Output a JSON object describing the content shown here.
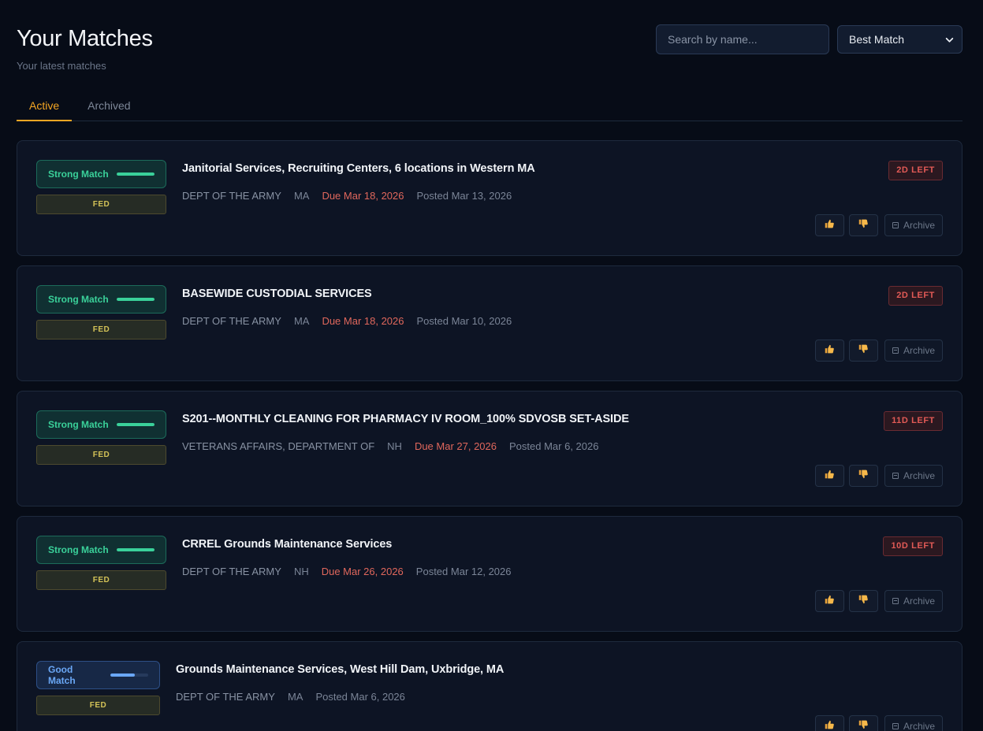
{
  "header": {
    "title": "Your Matches",
    "subtitle": "Your latest matches",
    "search_placeholder": "Search by name...",
    "sort_value": "Best Match"
  },
  "tabs": [
    {
      "label": "Active",
      "active": true
    },
    {
      "label": "Archived",
      "active": false
    }
  ],
  "archive_label": "Archive",
  "colors": {
    "accent": "#f5a623",
    "strong_match": "#3ad19a",
    "good_match": "#6aa7f5",
    "due": "#e0675c",
    "fed": "#d3c257"
  },
  "matches": [
    {
      "match_label": "Strong Match",
      "match_level": "strong",
      "match_fraction": 1.0,
      "type": "FED",
      "title": "Janitorial Services, Recruiting Centers, 6 locations in Western MA",
      "agency": "DEPT OF THE ARMY",
      "state": "MA",
      "due": "Due Mar 18, 2026",
      "posted": "Posted Mar 13, 2026",
      "days_left": "2D LEFT"
    },
    {
      "match_label": "Strong Match",
      "match_level": "strong",
      "match_fraction": 1.0,
      "type": "FED",
      "title": "BASEWIDE CUSTODIAL SERVICES",
      "agency": "DEPT OF THE ARMY",
      "state": "MA",
      "due": "Due Mar 18, 2026",
      "posted": "Posted Mar 10, 2026",
      "days_left": "2D LEFT"
    },
    {
      "match_label": "Strong Match",
      "match_level": "strong",
      "match_fraction": 1.0,
      "type": "FED",
      "title": "S201--MONTHLY CLEANING FOR PHARMACY IV ROOM_100% SDVOSB SET-ASIDE",
      "agency": "VETERANS AFFAIRS, DEPARTMENT OF",
      "state": "NH",
      "due": "Due Mar 27, 2026",
      "posted": "Posted Mar 6, 2026",
      "days_left": "11D LEFT"
    },
    {
      "match_label": "Strong Match",
      "match_level": "strong",
      "match_fraction": 1.0,
      "type": "FED",
      "title": "CRREL Grounds Maintenance Services",
      "agency": "DEPT OF THE ARMY",
      "state": "NH",
      "due": "Due Mar 26, 2026",
      "posted": "Posted Mar 12, 2026",
      "days_left": "10D LEFT"
    },
    {
      "match_label": "Good Match",
      "match_level": "good",
      "match_fraction": 0.65,
      "type": "FED",
      "title": "Grounds Maintenance Services, West Hill Dam, Uxbridge, MA",
      "agency": "DEPT OF THE ARMY",
      "state": "MA",
      "due": "",
      "posted": "Posted Mar 6, 2026",
      "days_left": ""
    }
  ]
}
